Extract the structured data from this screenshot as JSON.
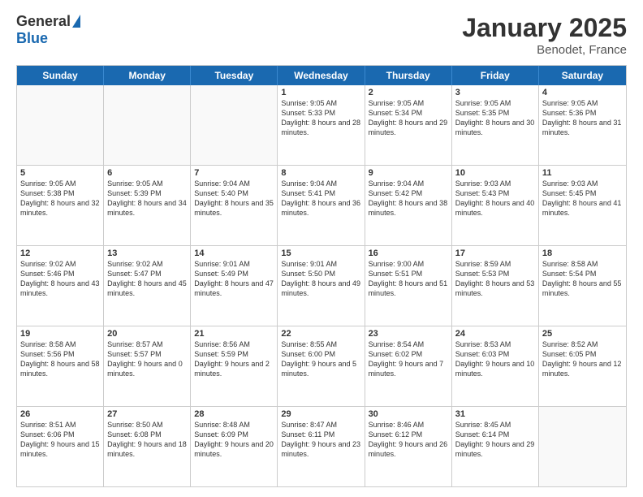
{
  "logo": {
    "general": "General",
    "blue": "Blue"
  },
  "header": {
    "month": "January 2025",
    "location": "Benodet, France"
  },
  "weekdays": [
    "Sunday",
    "Monday",
    "Tuesday",
    "Wednesday",
    "Thursday",
    "Friday",
    "Saturday"
  ],
  "rows": [
    [
      {
        "day": "",
        "sunrise": "",
        "sunset": "",
        "daylight": ""
      },
      {
        "day": "",
        "sunrise": "",
        "sunset": "",
        "daylight": ""
      },
      {
        "day": "",
        "sunrise": "",
        "sunset": "",
        "daylight": ""
      },
      {
        "day": "1",
        "sunrise": "Sunrise: 9:05 AM",
        "sunset": "Sunset: 5:33 PM",
        "daylight": "Daylight: 8 hours and 28 minutes."
      },
      {
        "day": "2",
        "sunrise": "Sunrise: 9:05 AM",
        "sunset": "Sunset: 5:34 PM",
        "daylight": "Daylight: 8 hours and 29 minutes."
      },
      {
        "day": "3",
        "sunrise": "Sunrise: 9:05 AM",
        "sunset": "Sunset: 5:35 PM",
        "daylight": "Daylight: 8 hours and 30 minutes."
      },
      {
        "day": "4",
        "sunrise": "Sunrise: 9:05 AM",
        "sunset": "Sunset: 5:36 PM",
        "daylight": "Daylight: 8 hours and 31 minutes."
      }
    ],
    [
      {
        "day": "5",
        "sunrise": "Sunrise: 9:05 AM",
        "sunset": "Sunset: 5:38 PM",
        "daylight": "Daylight: 8 hours and 32 minutes."
      },
      {
        "day": "6",
        "sunrise": "Sunrise: 9:05 AM",
        "sunset": "Sunset: 5:39 PM",
        "daylight": "Daylight: 8 hours and 34 minutes."
      },
      {
        "day": "7",
        "sunrise": "Sunrise: 9:04 AM",
        "sunset": "Sunset: 5:40 PM",
        "daylight": "Daylight: 8 hours and 35 minutes."
      },
      {
        "day": "8",
        "sunrise": "Sunrise: 9:04 AM",
        "sunset": "Sunset: 5:41 PM",
        "daylight": "Daylight: 8 hours and 36 minutes."
      },
      {
        "day": "9",
        "sunrise": "Sunrise: 9:04 AM",
        "sunset": "Sunset: 5:42 PM",
        "daylight": "Daylight: 8 hours and 38 minutes."
      },
      {
        "day": "10",
        "sunrise": "Sunrise: 9:03 AM",
        "sunset": "Sunset: 5:43 PM",
        "daylight": "Daylight: 8 hours and 40 minutes."
      },
      {
        "day": "11",
        "sunrise": "Sunrise: 9:03 AM",
        "sunset": "Sunset: 5:45 PM",
        "daylight": "Daylight: 8 hours and 41 minutes."
      }
    ],
    [
      {
        "day": "12",
        "sunrise": "Sunrise: 9:02 AM",
        "sunset": "Sunset: 5:46 PM",
        "daylight": "Daylight: 8 hours and 43 minutes."
      },
      {
        "day": "13",
        "sunrise": "Sunrise: 9:02 AM",
        "sunset": "Sunset: 5:47 PM",
        "daylight": "Daylight: 8 hours and 45 minutes."
      },
      {
        "day": "14",
        "sunrise": "Sunrise: 9:01 AM",
        "sunset": "Sunset: 5:49 PM",
        "daylight": "Daylight: 8 hours and 47 minutes."
      },
      {
        "day": "15",
        "sunrise": "Sunrise: 9:01 AM",
        "sunset": "Sunset: 5:50 PM",
        "daylight": "Daylight: 8 hours and 49 minutes."
      },
      {
        "day": "16",
        "sunrise": "Sunrise: 9:00 AM",
        "sunset": "Sunset: 5:51 PM",
        "daylight": "Daylight: 8 hours and 51 minutes."
      },
      {
        "day": "17",
        "sunrise": "Sunrise: 8:59 AM",
        "sunset": "Sunset: 5:53 PM",
        "daylight": "Daylight: 8 hours and 53 minutes."
      },
      {
        "day": "18",
        "sunrise": "Sunrise: 8:58 AM",
        "sunset": "Sunset: 5:54 PM",
        "daylight": "Daylight: 8 hours and 55 minutes."
      }
    ],
    [
      {
        "day": "19",
        "sunrise": "Sunrise: 8:58 AM",
        "sunset": "Sunset: 5:56 PM",
        "daylight": "Daylight: 8 hours and 58 minutes."
      },
      {
        "day": "20",
        "sunrise": "Sunrise: 8:57 AM",
        "sunset": "Sunset: 5:57 PM",
        "daylight": "Daylight: 9 hours and 0 minutes."
      },
      {
        "day": "21",
        "sunrise": "Sunrise: 8:56 AM",
        "sunset": "Sunset: 5:59 PM",
        "daylight": "Daylight: 9 hours and 2 minutes."
      },
      {
        "day": "22",
        "sunrise": "Sunrise: 8:55 AM",
        "sunset": "Sunset: 6:00 PM",
        "daylight": "Daylight: 9 hours and 5 minutes."
      },
      {
        "day": "23",
        "sunrise": "Sunrise: 8:54 AM",
        "sunset": "Sunset: 6:02 PM",
        "daylight": "Daylight: 9 hours and 7 minutes."
      },
      {
        "day": "24",
        "sunrise": "Sunrise: 8:53 AM",
        "sunset": "Sunset: 6:03 PM",
        "daylight": "Daylight: 9 hours and 10 minutes."
      },
      {
        "day": "25",
        "sunrise": "Sunrise: 8:52 AM",
        "sunset": "Sunset: 6:05 PM",
        "daylight": "Daylight: 9 hours and 12 minutes."
      }
    ],
    [
      {
        "day": "26",
        "sunrise": "Sunrise: 8:51 AM",
        "sunset": "Sunset: 6:06 PM",
        "daylight": "Daylight: 9 hours and 15 minutes."
      },
      {
        "day": "27",
        "sunrise": "Sunrise: 8:50 AM",
        "sunset": "Sunset: 6:08 PM",
        "daylight": "Daylight: 9 hours and 18 minutes."
      },
      {
        "day": "28",
        "sunrise": "Sunrise: 8:48 AM",
        "sunset": "Sunset: 6:09 PM",
        "daylight": "Daylight: 9 hours and 20 minutes."
      },
      {
        "day": "29",
        "sunrise": "Sunrise: 8:47 AM",
        "sunset": "Sunset: 6:11 PM",
        "daylight": "Daylight: 9 hours and 23 minutes."
      },
      {
        "day": "30",
        "sunrise": "Sunrise: 8:46 AM",
        "sunset": "Sunset: 6:12 PM",
        "daylight": "Daylight: 9 hours and 26 minutes."
      },
      {
        "day": "31",
        "sunrise": "Sunrise: 8:45 AM",
        "sunset": "Sunset: 6:14 PM",
        "daylight": "Daylight: 9 hours and 29 minutes."
      },
      {
        "day": "",
        "sunrise": "",
        "sunset": "",
        "daylight": ""
      }
    ]
  ]
}
